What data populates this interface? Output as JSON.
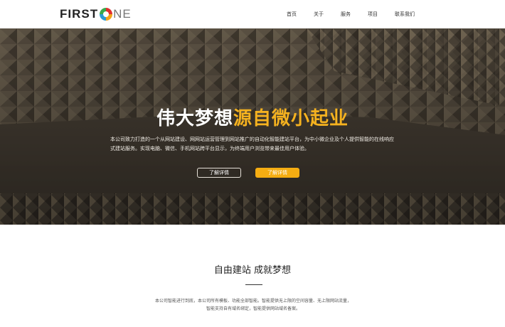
{
  "brand": {
    "logo_part1": "FIRST",
    "logo_part2": "NE"
  },
  "nav": {
    "items": [
      "首页",
      "关于",
      "服务",
      "项目",
      "联系我们"
    ]
  },
  "hero": {
    "title_white": "伟大梦想",
    "title_highlight": "源自微小起业",
    "description": "本公司致力打造的一个从网站建设、网网站运营管理到网站推广的自动化智能建站平台，为中小微企业及个人提供智能的在线响应式建站服务。实现电脑、微信、手机网站跨平台显示，为终端用户浏览带来最佳用户体验。",
    "button_secondary": "了解详情",
    "button_primary": "了解详情",
    "highlight_color": "#f5b21f",
    "button_color": "#f5ad12"
  },
  "section": {
    "title": "自由建站 成就梦想",
    "description": "本公司智能进行到底，本公司所有模板、功能全部智能。智能提供无上限的空间容量、无上限网站流量，智能支持自有域名绑定，智能提供网站域名备案。"
  }
}
